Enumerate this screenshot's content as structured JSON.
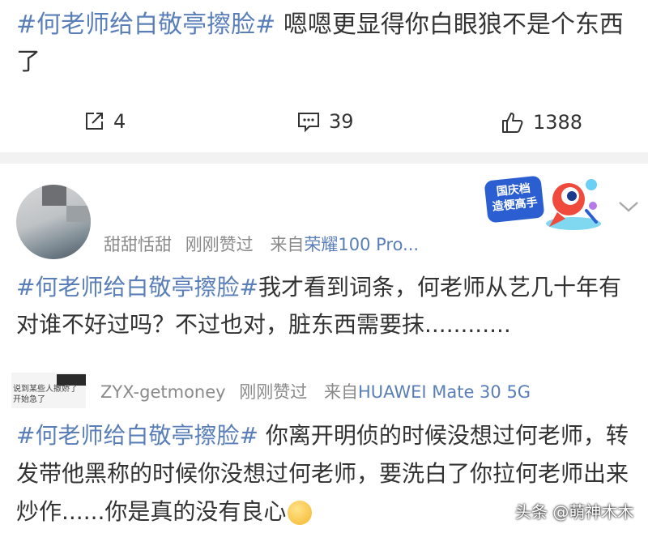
{
  "post": {
    "topic": "#何老师给白敬亭擦脸#",
    "text": " 嗯嗯更显得你白眼狼不是个东西了"
  },
  "actions": {
    "repost_count": "4",
    "comment_count": "39",
    "like_count": "1388"
  },
  "comment1": {
    "username": "甜甜恬甜",
    "liked_time": "刚刚赞过",
    "from_label": "来自",
    "device": "荣耀100 Pro...",
    "topic": "#何老师给白敬亭擦脸#",
    "text": "我才看到词条，何老师从艺几十年有对谁不好过吗？不过也对，脏东西需要抹............",
    "badge": "国庆档\n造梗高手"
  },
  "comment2": {
    "avatar_text": "说到某些人撒娇了\n开始急了",
    "username": "ZYX-getmoney",
    "liked_time": "刚刚赞过",
    "from_label": "来自",
    "device": "HUAWEI Mate 30 5G",
    "topic": "#何老师给白敬亭擦脸#",
    "text": " 你离开明侦的时候没想过何老师，转发带他黑称的时候你没想过何老师，要洗白了你拉何老师出来炒作......你是真的没有良心"
  },
  "watermark": "头条 @萌神木木",
  "colors": {
    "topic": "#5a7fb8",
    "meta": "#8a8a8a",
    "divider": "#f2f2f2"
  }
}
